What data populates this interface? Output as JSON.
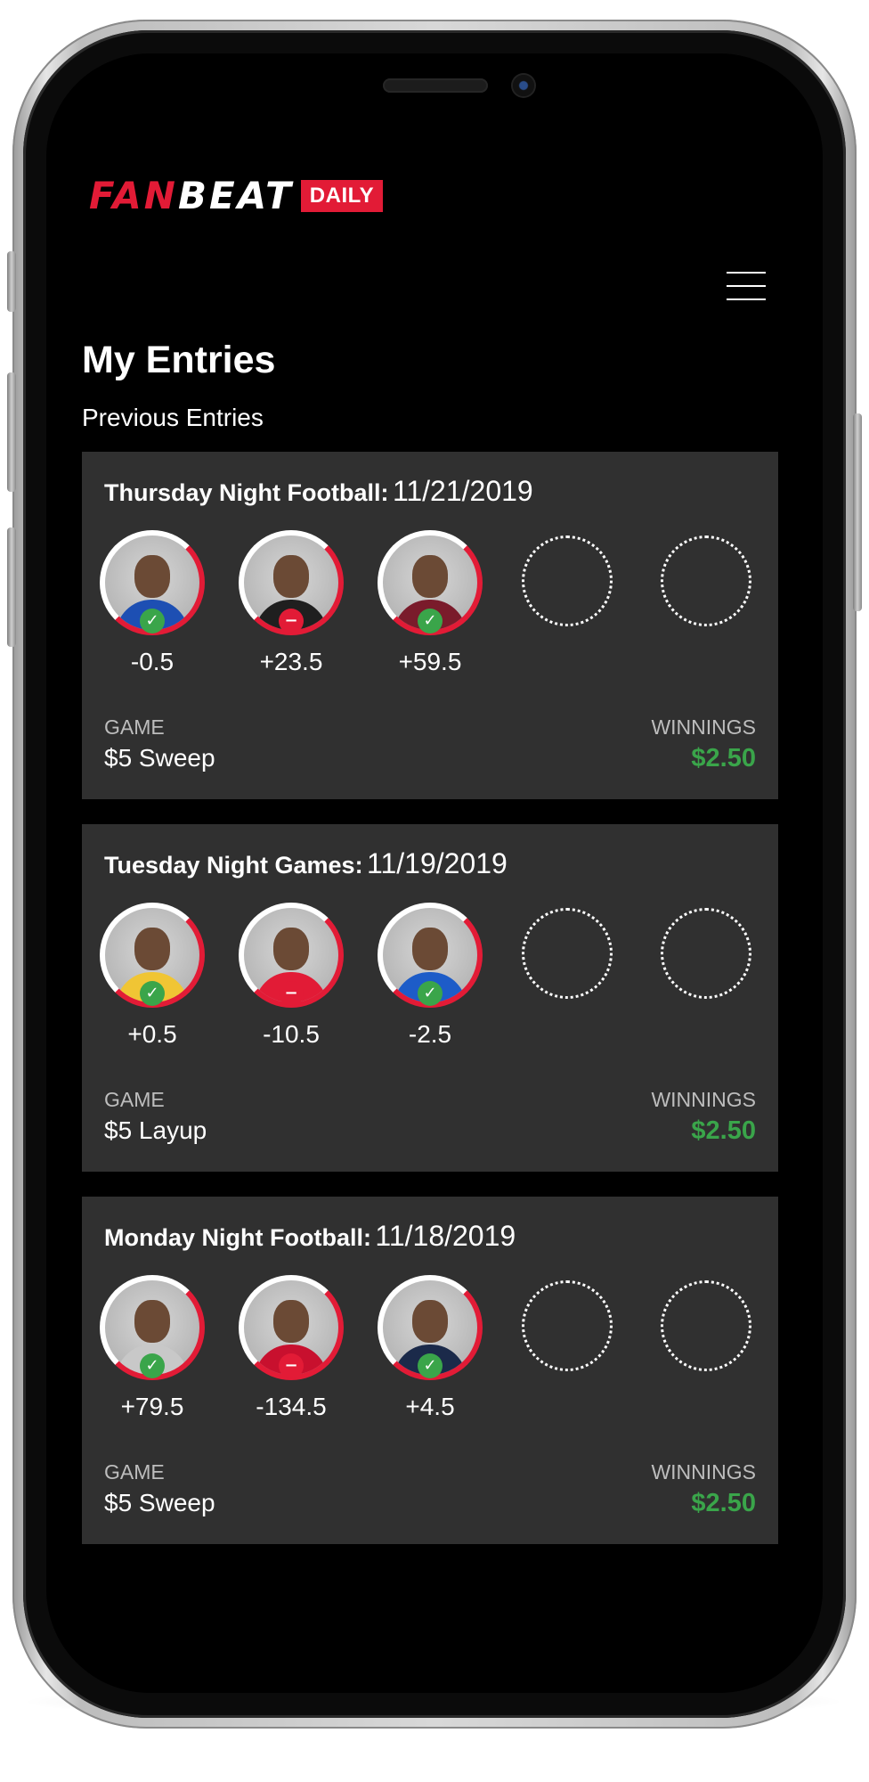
{
  "app": {
    "logo_fan": "FAN",
    "logo_beat": "BEAT",
    "logo_badge": "DAILY"
  },
  "page": {
    "title": "My Entries",
    "section": "Previous Entries"
  },
  "entries": [
    {
      "event": "Thursday Night Football:",
      "date": "11/21/2019",
      "picks": [
        {
          "spread": "-0.5",
          "result": "win",
          "jersey_color": "#1d4fb3"
        },
        {
          "spread": "+23.5",
          "result": "loss",
          "jersey_color": "#1f1f1f"
        },
        {
          "spread": "+59.5",
          "result": "win",
          "jersey_color": "#7a1b2b"
        }
      ],
      "game_label": "GAME",
      "game": "$5 Sweep",
      "winnings_label": "WINNINGS",
      "winnings": "$2.50"
    },
    {
      "event": "Tuesday Night Games:",
      "date": "11/19/2019",
      "picks": [
        {
          "spread": "+0.5",
          "result": "win",
          "jersey_color": "#f0c534"
        },
        {
          "spread": "-10.5",
          "result": "loss",
          "jersey_color": "#e21b36"
        },
        {
          "spread": "-2.5",
          "result": "win",
          "jersey_color": "#1d5cc8"
        }
      ],
      "game_label": "GAME",
      "game": "$5 Layup",
      "winnings_label": "WINNINGS",
      "winnings": "$2.50"
    },
    {
      "event": "Monday Night Football:",
      "date": "11/18/2019",
      "picks": [
        {
          "spread": "+79.5",
          "result": "win",
          "jersey_color": "#c8c8c8"
        },
        {
          "spread": "-134.5",
          "result": "loss",
          "jersey_color": "#c8102e"
        },
        {
          "spread": "+4.5",
          "result": "win",
          "jersey_color": "#1b2a4a"
        }
      ],
      "game_label": "GAME",
      "game": "$5 Sweep",
      "winnings_label": "WINNINGS",
      "winnings": "$2.50"
    }
  ],
  "icons": {
    "win": "check-icon",
    "loss": "minus-icon",
    "menu": "hamburger-menu-icon"
  },
  "colors": {
    "brand_red": "#e21b36",
    "win_green": "#3aa54a",
    "card_bg": "#303030",
    "screen_bg": "#000000"
  }
}
